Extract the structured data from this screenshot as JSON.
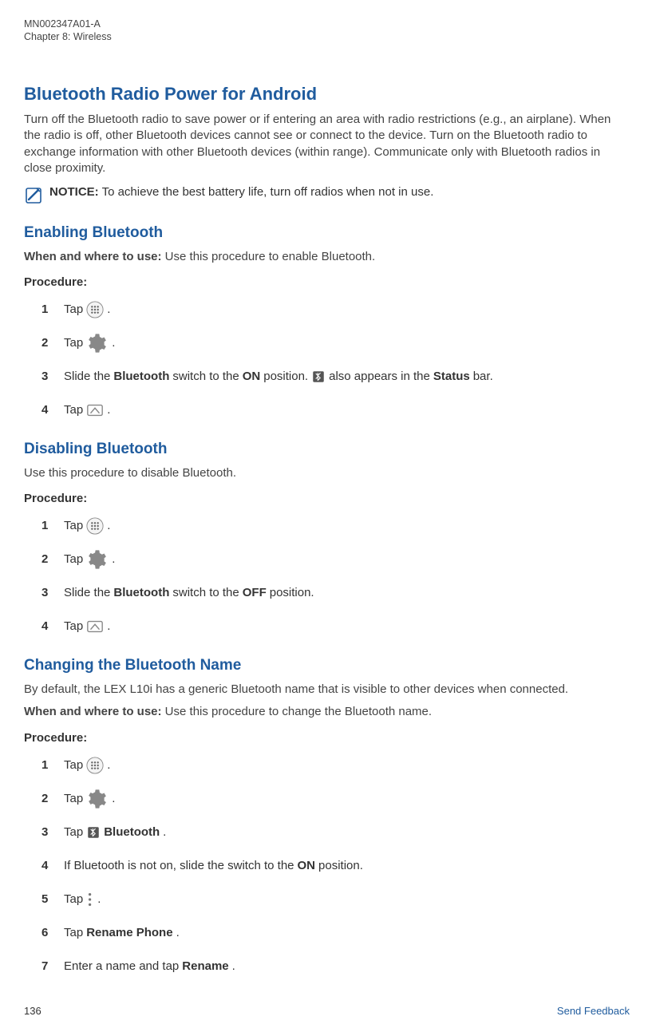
{
  "header": {
    "doc_id": "MN002347A01-A",
    "chapter_line": "Chapter 8:  Wireless"
  },
  "section1": {
    "title": "Bluetooth Radio Power for Android",
    "intro": "Turn off the Bluetooth radio to save power or if entering an area with radio restrictions (e.g., an airplane). When the radio is off, other Bluetooth devices cannot see or connect to the device. Turn on the Bluetooth radio to exchange information with other Bluetooth devices (within range). Communicate only with Bluetooth radios in close proximity.",
    "notice_label": "NOTICE:",
    "notice_text": " To achieve the best battery life, turn off radios when not in use."
  },
  "section2": {
    "title": "Enabling Bluetooth",
    "wwtu_label": "When and where to use:",
    "wwtu_text": " Use this procedure to enable Bluetooth.",
    "procedure_label": "Procedure:",
    "steps": {
      "s1_pre": "Tap ",
      "s2_pre": "Tap ",
      "s3_pre": "Slide the ",
      "s3_bt": "Bluetooth",
      "s3_mid": " switch to the ",
      "s3_on": "ON",
      "s3_post1": " position. ",
      "s3_post2": " also appears in the ",
      "s3_status": "Status",
      "s3_post3": " bar.",
      "s4_pre": "Tap "
    }
  },
  "section3": {
    "title": "Disabling Bluetooth",
    "intro": "Use this procedure to disable Bluetooth.",
    "procedure_label": "Procedure:",
    "steps": {
      "s1_pre": "Tap ",
      "s2_pre": "Tap ",
      "s3_pre": "Slide the ",
      "s3_bt": "Bluetooth",
      "s3_mid": " switch to the ",
      "s3_off": "OFF",
      "s3_post": " position.",
      "s4_pre": "Tap "
    }
  },
  "section4": {
    "title": "Changing the Bluetooth Name",
    "intro": "By default, the LEX L10i has a generic Bluetooth name that is visible to other devices when connected.",
    "wwtu_label": "When and where to use:",
    "wwtu_text": " Use this procedure to change the Bluetooth name.",
    "procedure_label": "Procedure:",
    "steps": {
      "s1_pre": "Tap ",
      "s2_pre": "Tap ",
      "s3_pre": "Tap ",
      "s3_bt": " Bluetooth",
      "s4_pre": "If Bluetooth is not on, slide the switch to the ",
      "s4_on": "ON",
      "s4_post": " position.",
      "s5_pre": "Tap ",
      "s6_pre": "Tap ",
      "s6_bold": "Rename Phone",
      "s7_pre": "Enter a name and tap ",
      "s7_bold": "Rename"
    }
  },
  "footer": {
    "page": "136",
    "feedback": "Send Feedback"
  },
  "nums": {
    "n1": "1",
    "n2": "2",
    "n3": "3",
    "n4": "4",
    "n5": "5",
    "n6": "6",
    "n7": "7"
  },
  "punct": {
    "period": "."
  }
}
